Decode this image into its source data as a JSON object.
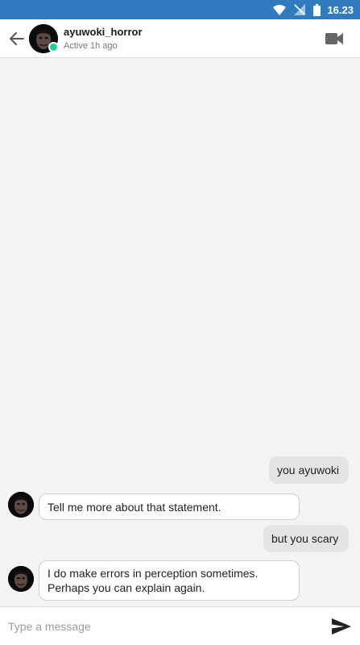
{
  "status_bar": {
    "time": "16.23",
    "icons": [
      "wifi-icon",
      "no-signal-icon",
      "battery-icon"
    ]
  },
  "header": {
    "back_icon": "arrow-left-icon",
    "contact_name": "ayuwoki_horror",
    "status_text": "Active 1h ago",
    "online_color": "#1ccf9a",
    "video_icon": "video-camera-icon"
  },
  "messages": [
    {
      "direction": "outgoing",
      "text": "you ayuwoki"
    },
    {
      "direction": "incoming",
      "text": "Tell me more about that statement."
    },
    {
      "direction": "outgoing",
      "text": "but you scary"
    },
    {
      "direction": "incoming",
      "line1": "I do make errors in perception sometimes.",
      "line2": "Perhaps you can explain again."
    }
  ],
  "composer": {
    "placeholder": "Type a message",
    "value": "",
    "send_icon": "send-icon"
  },
  "colors": {
    "status_bar": "#2f7bbd",
    "chat_background": "#f4f4f4",
    "outgoing_bubble": "#e4e4e4",
    "incoming_bubble": "#ffffff"
  }
}
